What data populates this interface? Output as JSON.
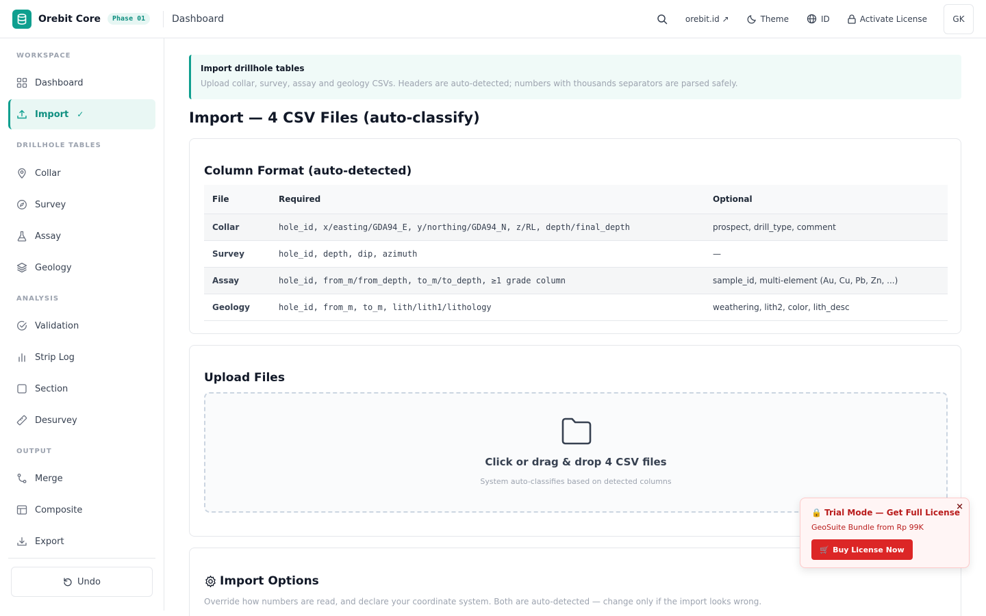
{
  "app": {
    "name": "Orebit Core",
    "phase": "Phase 01",
    "page": "Dashboard"
  },
  "topbar": {
    "site_link": "orebit.id ↗",
    "theme": "Theme",
    "language": "ID",
    "activate": "Activate License",
    "avatar": "GK"
  },
  "sidebar": {
    "sections": [
      {
        "label": "WORKSPACE"
      },
      {
        "label": "DRILLHOLE TABLES"
      },
      {
        "label": "ANALYSIS"
      },
      {
        "label": "OUTPUT"
      }
    ],
    "items": [
      {
        "label": "Dashboard",
        "icon": "grid-icon"
      },
      {
        "label": "Import",
        "icon": "upload-icon",
        "check": "✓"
      },
      {
        "label": "Collar",
        "icon": "map-pin-icon"
      },
      {
        "label": "Survey",
        "icon": "compass-icon"
      },
      {
        "label": "Assay",
        "icon": "flask-icon"
      },
      {
        "label": "Geology",
        "icon": "layers-icon"
      },
      {
        "label": "Validation",
        "icon": "check-circle-icon"
      },
      {
        "label": "Strip Log",
        "icon": "bar-chart-icon"
      },
      {
        "label": "Section",
        "icon": "square-icon"
      },
      {
        "label": "Desurvey",
        "icon": "ruler-icon"
      },
      {
        "label": "Merge",
        "icon": "merge-icon"
      },
      {
        "label": "Composite",
        "icon": "table-icon"
      },
      {
        "label": "Export",
        "icon": "download-icon"
      }
    ],
    "undo": "Undo"
  },
  "banner": {
    "title": "Import drillhole tables",
    "description": "Upload collar, survey, assay and geology CSVs. Headers are auto-detected; numbers with thousands separators are parsed safely."
  },
  "page_title": "Import — 4 CSV Files (auto-classify)",
  "format_card": {
    "title": "Column Format (auto-detected)",
    "headers": [
      "File",
      "Required",
      "Optional"
    ],
    "rows": [
      {
        "file": "Collar",
        "required": "hole_id, x/easting/GDA94_E, y/northing/GDA94_N, z/RL, depth/final_depth",
        "optional": "prospect, drill_type, comment"
      },
      {
        "file": "Survey",
        "required": "hole_id, depth, dip, azimuth",
        "optional": "—"
      },
      {
        "file": "Assay",
        "required": "hole_id, from_m/from_depth, to_m/to_depth, ≥1 grade column",
        "optional": "sample_id, multi-element (Au, Cu, Pb, Zn, ...)"
      },
      {
        "file": "Geology",
        "required": "hole_id, from_m, to_m, lith/lith1/lithology",
        "optional": "weathering, lith2, color, lith_desc"
      }
    ]
  },
  "upload_card": {
    "title": "Upload Files",
    "drop_title": "Click or drag & drop 4 CSV files",
    "drop_sub": "System auto-classifies based on detected columns"
  },
  "options_card": {
    "title": "Import Options",
    "description": "Override how numbers are read, and declare your coordinate system. Both are auto-detected — change only if the import looks wrong."
  },
  "trial": {
    "title": "Trial Mode — Get Full License",
    "subtitle": "GeoSuite Bundle from Rp 99K",
    "button": "Buy License Now",
    "close": "×"
  },
  "colors": {
    "accent": "#0f9f8f",
    "danger": "#dc2626"
  }
}
